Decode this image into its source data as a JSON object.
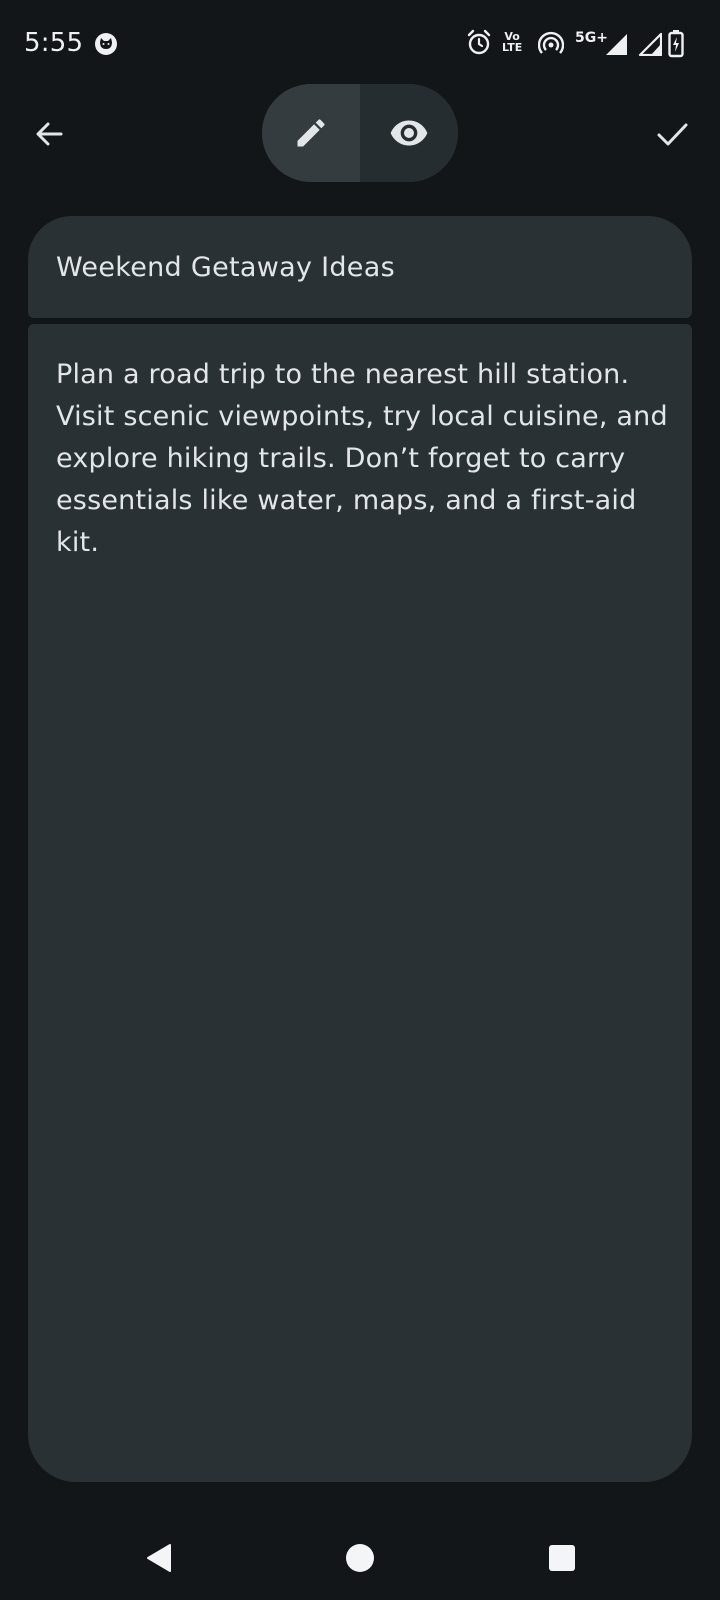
{
  "status_bar": {
    "time": "5:55",
    "app_icon": "cat-face-icon",
    "icons": [
      "alarm-icon",
      "volte-icon",
      "hotspot-icon",
      "5g-signal-icon",
      "signal-icon",
      "signal-icon",
      "battery-charging-icon"
    ],
    "volte_top": "Vo",
    "volte_bottom": "LTE",
    "network": "5G+"
  },
  "toolbar": {
    "back_icon": "arrow-back-icon",
    "edit_icon": "pencil-icon",
    "preview_icon": "eye-icon",
    "save_icon": "checkmark-icon",
    "active_mode": "edit"
  },
  "note": {
    "title": "Weekend Getaway Ideas",
    "body": "Plan a road trip to the nearest hill station. Visit scenic viewpoints, try local cuisine, and explore hiking trails. Don’t forget to carry essentials like water, maps, and a first-aid kit."
  },
  "nav_bar": {
    "icons": [
      "back-triangle-icon",
      "home-circle-icon",
      "recents-square-icon"
    ]
  },
  "colors": {
    "background": "#121619",
    "card": "#2a3135",
    "toggle_active": "#343c40",
    "text": "#e3e6e8"
  }
}
